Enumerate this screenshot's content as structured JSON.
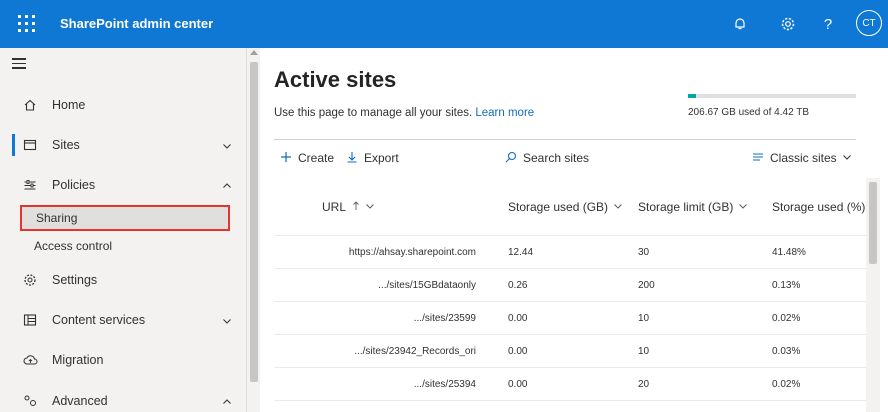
{
  "topbar": {
    "app_title": "SharePoint admin center",
    "icons": [
      "waffle-icon",
      "bell-icon",
      "gear-icon",
      "help-icon"
    ],
    "avatar_initials": "CT",
    "bg_color": "#0f78d4"
  },
  "nav": {
    "items": [
      {
        "label": "Home",
        "icon": "home-icon"
      },
      {
        "label": "Sites",
        "icon": "sites-icon",
        "expanded": false
      },
      {
        "label": "Policies",
        "icon": "policies-icon",
        "expanded": true
      },
      {
        "label": "Settings",
        "icon": "gear-icon"
      },
      {
        "label": "Content services",
        "icon": "content-services-icon",
        "expanded": false
      },
      {
        "label": "Migration",
        "icon": "cloud-icon"
      },
      {
        "label": "Advanced",
        "icon": "advanced-icon",
        "expanded": true
      }
    ],
    "policies_children": [
      {
        "label": "Sharing",
        "selected": true
      },
      {
        "label": "Access control",
        "selected": false
      }
    ]
  },
  "main": {
    "title": "Active sites",
    "description": "Use this page to manage all your sites.",
    "learn_more": "Learn more",
    "storage": {
      "text": "206.67 GB used of 4.42 TB",
      "fraction": 0.046
    },
    "commands": {
      "create": "Create",
      "export": "Export",
      "search": "Search sites",
      "view": "Classic sites"
    },
    "table": {
      "headers": {
        "url": "URL",
        "storage_used_gb": "Storage used (GB)",
        "storage_limit_gb": "Storage limit (GB)",
        "storage_used_pct": "Storage used (%)"
      },
      "rows": [
        {
          "url": "https://ahsay.sharepoint.com",
          "used": "12.44",
          "limit": "30",
          "pct": "41.48%"
        },
        {
          "url": ".../sites/15GBdataonly",
          "used": "0.26",
          "limit": "200",
          "pct": "0.13%"
        },
        {
          "url": ".../sites/23599",
          "used": "0.00",
          "limit": "10",
          "pct": "0.02%"
        },
        {
          "url": ".../sites/23942_Records_ori",
          "used": "0.00",
          "limit": "10",
          "pct": "0.03%"
        },
        {
          "url": ".../sites/25394",
          "used": "0.00",
          "limit": "20",
          "pct": "0.02%"
        }
      ]
    }
  }
}
